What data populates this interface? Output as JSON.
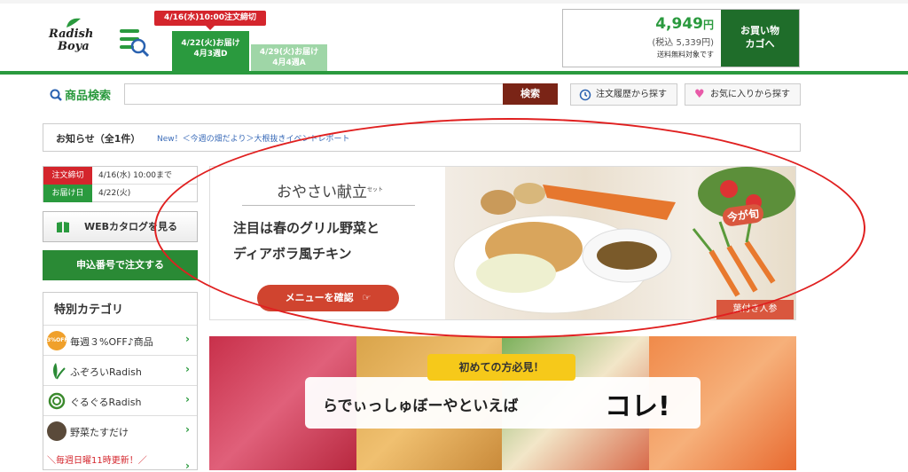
{
  "header": {
    "logo_line1": "Radish",
    "logo_line2": "Boya",
    "deadline_notice": "4/16(水)10:00注文締切",
    "delivery_tabs": [
      {
        "line1": "4/22(火)お届け",
        "line2": "4月3週D"
      },
      {
        "line1": "4/29(火)お届け",
        "line2": "4月4週A"
      }
    ],
    "cart": {
      "price": "4,949",
      "currency": "円",
      "tax_included": "(税込 5,339円)",
      "free_shipping": "送料無料対象です",
      "button_line1": "お買い物",
      "button_line2": "カゴへ"
    }
  },
  "search": {
    "label": "商品検索",
    "placeholder": "",
    "button": "検索",
    "history_button": "注文履歴から探す",
    "favorites_button": "お気に入りから探す"
  },
  "notice": {
    "title": "お知らせ（全1件）",
    "link": "New！＜今週の畑だより＞大根抜きイベントレポート"
  },
  "sidebar": {
    "order_info": [
      {
        "key": "注文締切",
        "value": "4/16(水) 10:00まで"
      },
      {
        "key": "お届け日",
        "value": "4/22(火)"
      }
    ],
    "catalog_button": "WEBカタログを見る",
    "apply_button": "申込番号で注文する",
    "special_title": "特別カテゴリ",
    "categories": [
      {
        "label": "毎週３%OFF♪商品",
        "icon": "3-percent-off-icon",
        "icon_text": "3%OFF"
      },
      {
        "label": "ふぞろいRadish",
        "icon": "radish-leaf-icon"
      },
      {
        "label": "ぐるぐるRadish",
        "icon": "spiral-icon"
      },
      {
        "label": "野菜たすだけ",
        "icon": "yasai-tasudake-icon"
      }
    ],
    "weekly_update": "＼毎週日曜11時更新！／"
  },
  "banner1": {
    "title": "おやさい献立",
    "title_ruby": "セット",
    "line1": "注目は春のグリル野菜と",
    "line2": "ディアボラ風チキン",
    "button": "メニューを確認",
    "season_tag": "今が旬",
    "badge": "葉付き人参"
  },
  "banner2": {
    "tag": "初めての方必見！",
    "text": "らでぃっしゅぼーやといえば",
    "big": "コレ!"
  },
  "colors": {
    "brand_green": "#2a9a3e",
    "deadline_red": "#d4252c",
    "search_button": "#7a2416",
    "annotation_red": "#e02020"
  }
}
